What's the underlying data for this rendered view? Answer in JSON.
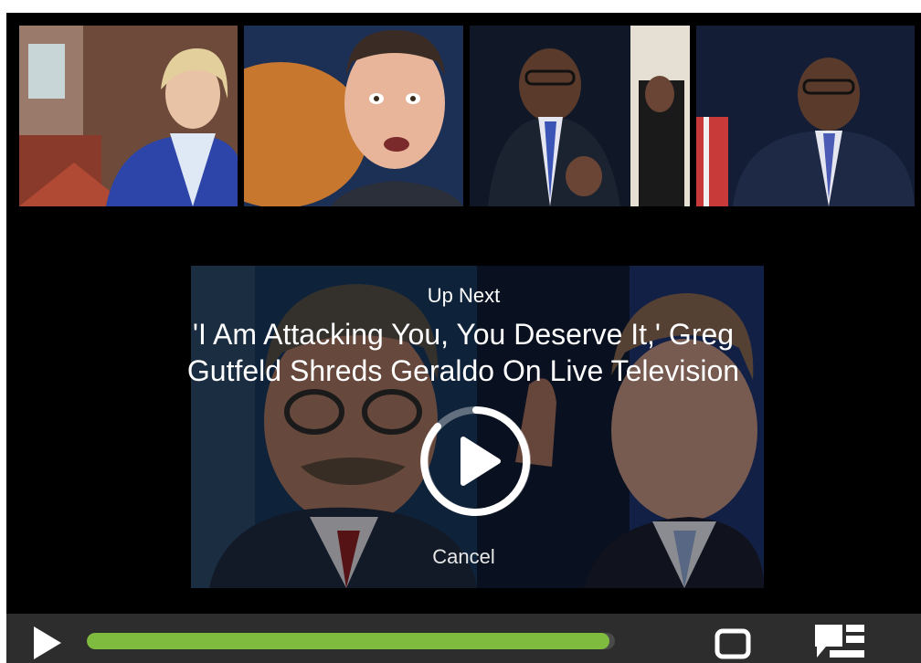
{
  "overlay": {
    "up_next_label": "Up Next",
    "title": "'I Am Attacking You, You Deserve It,' Greg Gutfeld Shreds Geraldo On Live Television",
    "cancel_label": "Cancel"
  },
  "controls": {
    "play_icon": "play-icon",
    "fullscreen_icon": "fullscreen-icon",
    "captions_icon": "captions-icon",
    "progress": 0.99
  },
  "colors": {
    "accent": "#7fbb3f",
    "control_bar": "#2d2d2d",
    "player_bg": "#000000",
    "icon": "#ffffff"
  }
}
